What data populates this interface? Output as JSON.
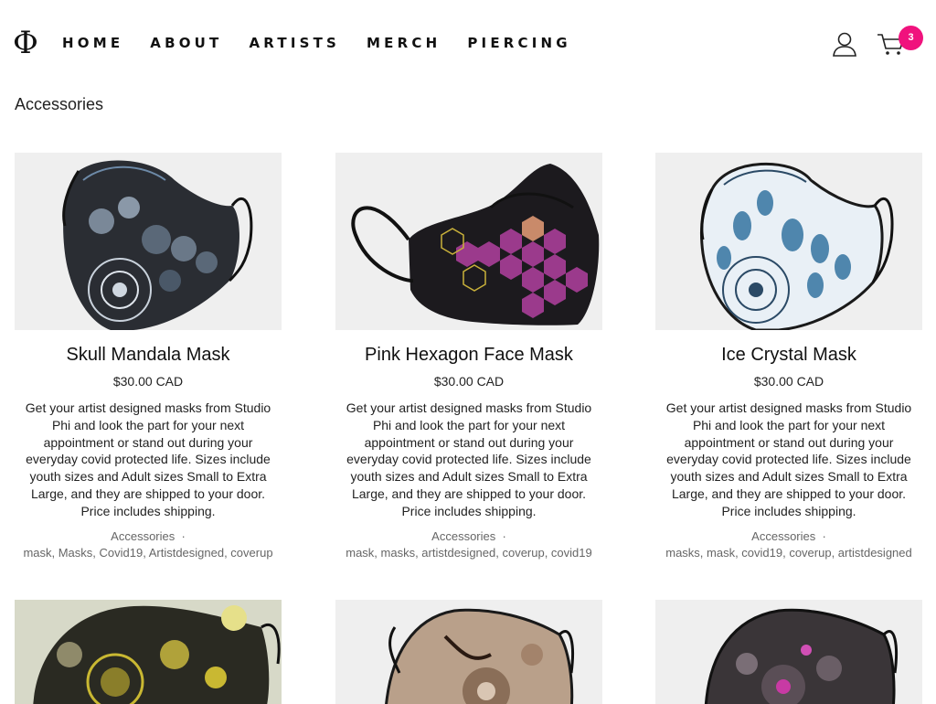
{
  "header": {
    "logo": "Φ",
    "nav": [
      "HOME",
      "ABOUT",
      "ARTISTS",
      "MERCH",
      "PIERCING"
    ],
    "cart_count": "3"
  },
  "category": {
    "title": "Accessories"
  },
  "products": [
    {
      "title": "Skull Mandala Mask",
      "price": "$30.00 CAD",
      "description": "Get your artist designed masks from Studio Phi and look the part for your next appointment or stand out during your everyday covid protected life. Sizes include youth sizes and Adult sizes Small to Extra Large, and they are shipped to your door. Price includes shipping.",
      "category": "Accessories",
      "tags": "mask, Masks, Covid19, Artistdesigned, coverup"
    },
    {
      "title": "Pink Hexagon Face Mask",
      "price": "$30.00 CAD",
      "description": "Get your artist designed masks from Studio Phi and look the part for your next appointment or stand out during your everyday covid protected life. Sizes include youth sizes and Adult sizes Small to Extra Large, and they are shipped to your door. Price includes shipping.",
      "category": "Accessories",
      "tags": "mask, masks, artistdesigned, coverup, covid19"
    },
    {
      "title": "Ice Crystal Mask",
      "price": "$30.00 CAD",
      "description": "Get your artist designed masks from Studio Phi and look the part for your next appointment or stand out during your everyday covid protected life. Sizes include youth sizes and Adult sizes Small to Extra Large, and they are shipped to your door. Price includes shipping.",
      "category": "Accessories",
      "tags": "masks, mask, covid19, coverup, artistdesigned"
    }
  ],
  "colors": {
    "badge": "#f0127d",
    "image_bg": "#efefef"
  },
  "icons": {
    "user": "user-icon",
    "cart": "cart-icon"
  }
}
